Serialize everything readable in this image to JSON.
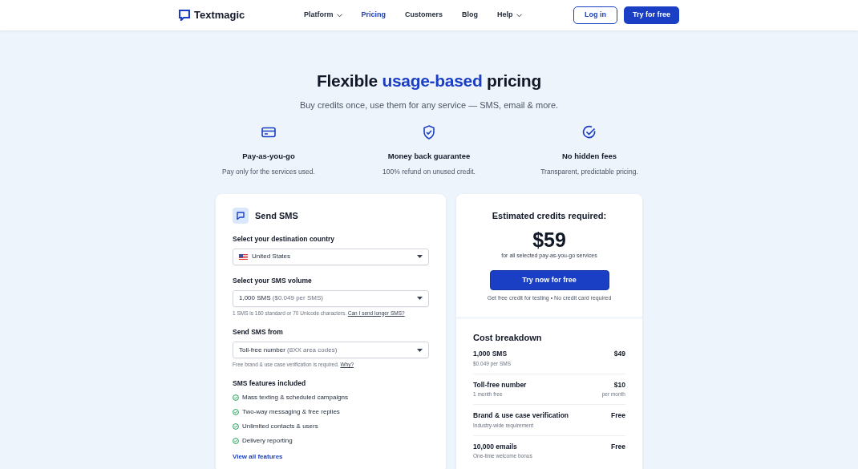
{
  "header": {
    "brand": "Textmagic",
    "nav": [
      {
        "label": "Platform",
        "dropdown": true,
        "selected": false
      },
      {
        "label": "Pricing",
        "dropdown": false,
        "selected": true
      },
      {
        "label": "Customers",
        "dropdown": false,
        "selected": false
      },
      {
        "label": "Blog",
        "dropdown": false,
        "selected": false
      },
      {
        "label": "Help",
        "dropdown": true,
        "selected": false
      }
    ],
    "login": "Log in",
    "cta": "Try for free"
  },
  "hero": {
    "title": [
      {
        "text": "Flexible ",
        "highlight": false
      },
      {
        "text": "usage-based",
        "highlight": true
      },
      {
        "text": " pricing",
        "highlight": false
      }
    ],
    "subtitle": "Buy credits once, use them for any service — SMS, email & more."
  },
  "features": [
    {
      "kind": "card",
      "title": "Pay-as-you-go",
      "text": "Pay only for the services used."
    },
    {
      "kind": "shield",
      "title": "Money back guarantee",
      "text": "100% refund on unused credit."
    },
    {
      "kind": "check",
      "title": "No hidden fees",
      "text": "Transparent, predictable pricing."
    }
  ],
  "sms_card": {
    "title": "Send SMS",
    "fields": [
      {
        "label": "Select your destination country",
        "flag": true,
        "value": "United States"
      },
      {
        "label": "Select your SMS volume",
        "flag": false,
        "value": "1,000 SMS",
        "detail": "($0.049 per SMS)",
        "hint": "1 SMS is 160 standard or 70 Unicode characters.",
        "hint_link": "Can I send longer SMS?"
      },
      {
        "label": "Send SMS from",
        "flag": false,
        "value": "Toll-free number",
        "detail": "(8XX area codes)",
        "hint": "Free brand & use case verification is required.",
        "hint_link": "Why?"
      }
    ],
    "features_title": "SMS features included",
    "features": [
      "Mass texting & scheduled campaigns",
      "Two-way messaging & free replies",
      "Unlimited contacts & users",
      "Delivery reporting"
    ],
    "link": "View all features"
  },
  "estimate": {
    "title": "Estimated credits required:",
    "amount": "$59",
    "caption": "for all selected pay-as-you-go services",
    "button": "Try now for free",
    "note": "Get free credit for testing • No credit card required"
  },
  "breakdown": {
    "title": "Cost breakdown",
    "rows": [
      {
        "name": "1,000 SMS",
        "sub": "$0.049 per SMS",
        "price": "$49"
      },
      {
        "name": "Toll-free number",
        "sub": "1 month free",
        "price": "$10",
        "price_sub": "per month"
      },
      {
        "name": "Brand & use case verification",
        "sub": "Industry-wide requirement",
        "price": "Free"
      },
      {
        "name": "10,000 emails",
        "sub": "One-time welcome bonus",
        "price": "Free"
      }
    ]
  }
}
